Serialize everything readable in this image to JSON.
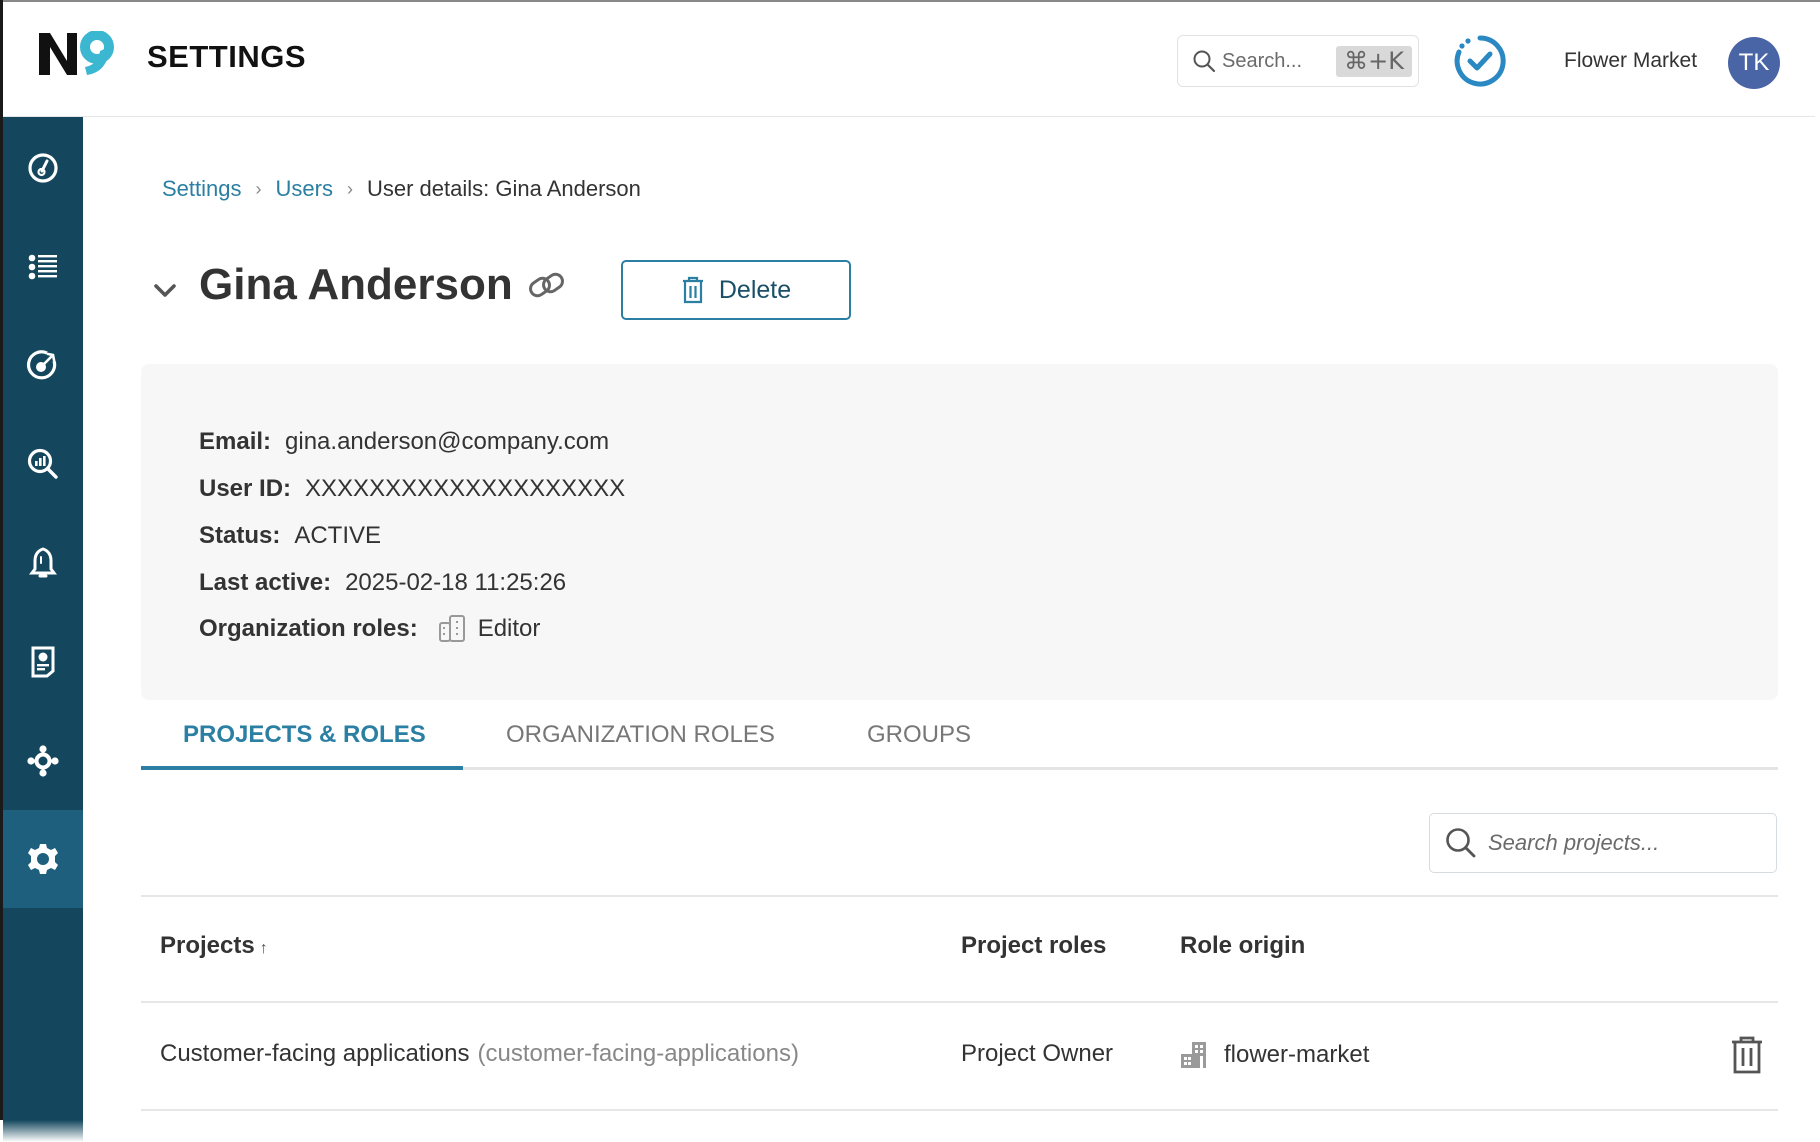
{
  "app": {
    "logo_text": "N9",
    "title": "SETTINGS"
  },
  "header": {
    "search_label": "Search...",
    "search_shortcut": "⌘+K",
    "org_name": "Flower Market",
    "avatar_initials": "TK"
  },
  "sidebar": {
    "items": [
      {
        "icon": "dashboard-gauge-icon",
        "active": false
      },
      {
        "icon": "list-icon",
        "active": false
      },
      {
        "icon": "target-icon",
        "active": false
      },
      {
        "icon": "analytics-search-icon",
        "active": false
      },
      {
        "icon": "bell-icon",
        "active": false
      },
      {
        "icon": "report-icon",
        "active": false
      },
      {
        "icon": "integrations-icon",
        "active": false
      },
      {
        "icon": "gear-icon",
        "active": true
      }
    ]
  },
  "breadcrumb": {
    "items": [
      "Settings",
      "Users"
    ],
    "current": "User details: Gina Anderson",
    "separator": "›"
  },
  "user": {
    "name": "Gina Anderson",
    "delete_label": "Delete",
    "details": [
      {
        "label": "Email:",
        "value": "gina.anderson@company.com"
      },
      {
        "label": "User ID:",
        "value": "XXXXXXXXXXXXXXXXXXXX"
      },
      {
        "label": "Status:",
        "value": "ACTIVE"
      },
      {
        "label": "Last active:",
        "value": "2025-02-18 11:25:26"
      },
      {
        "label": "Organization roles:",
        "value": "Editor"
      }
    ]
  },
  "tabs": [
    {
      "label": "PROJECTS & ROLES",
      "active": true
    },
    {
      "label": "ORGANIZATION ROLES",
      "active": false
    },
    {
      "label": "GROUPS",
      "active": false
    }
  ],
  "projects": {
    "search_placeholder": "Search projects...",
    "search_value": "",
    "columns": [
      {
        "label": "Projects",
        "sort": "↑"
      },
      {
        "label": "Project roles"
      },
      {
        "label": "Role origin"
      }
    ],
    "rows": [
      {
        "project": "Customer-facing applications",
        "slug": "(customer-facing-applications)",
        "role": "Project Owner",
        "origin": "flower-market"
      }
    ]
  },
  "colors": {
    "accent": "#2a7fa3",
    "sidebar": "#14475d",
    "sidebar_active": "#1e5f7e",
    "avatar": "#4a65a5",
    "logo_nine": "#3bb7d1"
  }
}
